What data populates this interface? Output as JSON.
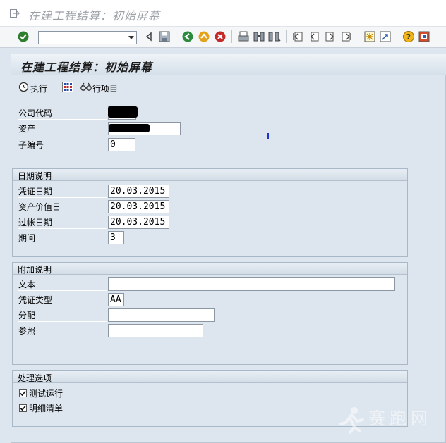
{
  "window": {
    "title": "在建工程结算：初始屏幕"
  },
  "screen": {
    "title": "在建工程结算：初始屏幕"
  },
  "app_toolbar": {
    "execute_label": "执行",
    "line_items_label": "行项目"
  },
  "main_fields": [
    {
      "label": "公司代码",
      "value": ""
    },
    {
      "label": "资产",
      "value": ""
    },
    {
      "label": "子编号",
      "value": "0"
    }
  ],
  "date_group": {
    "title": "日期说明",
    "fields": [
      {
        "label": "凭证日期",
        "value": "20.03.2015"
      },
      {
        "label": "资产价值日",
        "value": "20.03.2015"
      },
      {
        "label": "过帐日期",
        "value": "20.03.2015"
      },
      {
        "label": "期间",
        "value": "3"
      }
    ]
  },
  "extra_group": {
    "title": "附加说明",
    "fields": [
      {
        "label": "文本",
        "value": ""
      },
      {
        "label": "凭证类型",
        "value": "AA"
      },
      {
        "label": "分配",
        "value": ""
      },
      {
        "label": "参照",
        "value": ""
      }
    ]
  },
  "options_group": {
    "title": "处理选项",
    "checkboxes": [
      {
        "label": "测试运行",
        "checked": true
      },
      {
        "label": "明细清单",
        "checked": true
      }
    ]
  },
  "watermark": {
    "text": "赛跑网"
  }
}
